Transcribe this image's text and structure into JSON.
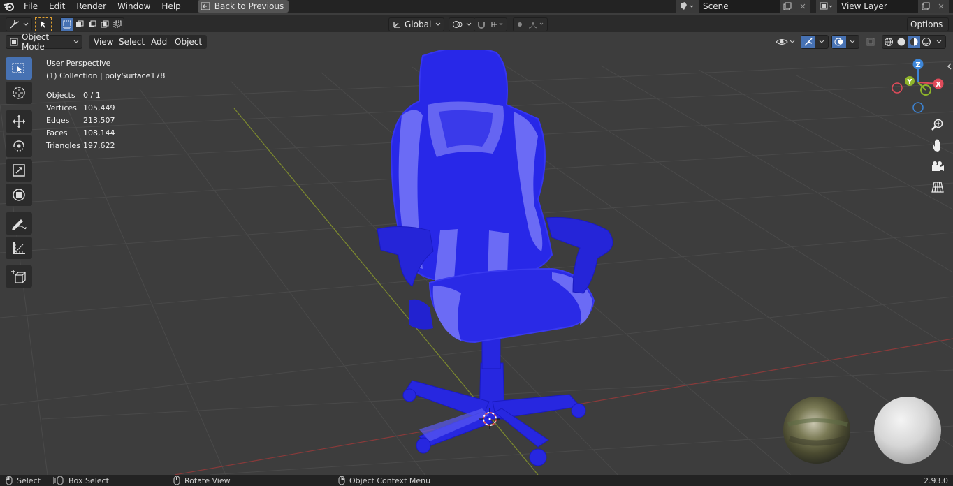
{
  "topbar": {
    "menus": [
      "File",
      "Edit",
      "Render",
      "Window",
      "Help"
    ],
    "back_label": "Back to Previous",
    "scene_name": "Scene",
    "view_layer": "View Layer"
  },
  "toolheader": {
    "orientation": "Global",
    "options_label": "Options"
  },
  "viewheader": {
    "mode": "Object Mode",
    "menus": [
      "View",
      "Select",
      "Add",
      "Object"
    ]
  },
  "overlay": {
    "perspective": "User Perspective",
    "collection": "(1) Collection | polySurface178",
    "stats": [
      {
        "label": "Objects",
        "value": "0 / 1"
      },
      {
        "label": "Vertices",
        "value": "105,449"
      },
      {
        "label": "Edges",
        "value": "213,507"
      },
      {
        "label": "Faces",
        "value": "108,144"
      },
      {
        "label": "Triangles",
        "value": "197,622"
      }
    ]
  },
  "gizmo": {
    "z": "Z",
    "y": "Y",
    "x": "X"
  },
  "statusbar": {
    "select": "Select",
    "box_select": "Box Select",
    "rotate_view": "Rotate View",
    "context_menu": "Object Context Menu",
    "version": "2.93.0"
  },
  "colors": {
    "accent": "#4772b3",
    "model": "#2a2ae6",
    "axis_x": "#e04b5a",
    "axis_y": "#8fb52a",
    "axis_z": "#3d86d8"
  }
}
